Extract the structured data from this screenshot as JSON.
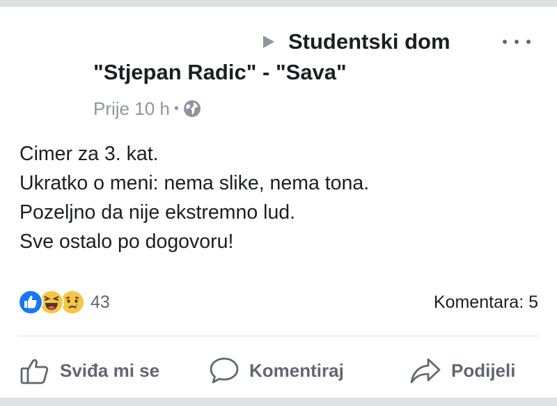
{
  "post": {
    "group_name_line1": "Studentski dom",
    "group_name_line2": "\"Stjepan Radic\" - \"Sava\"",
    "time": "Prije 10 h",
    "separator": "•",
    "privacy_icon": "globe-icon",
    "text_lines": [
      "Cimer za 3. kat.",
      "Ukratko o meni: nema slike, nema tona.",
      "Pozeljno da nije ekstremno lud.",
      "Sve ostalo po dogovoru!"
    ]
  },
  "reactions": {
    "icons": [
      "like-icon",
      "haha-icon",
      "sad-icon"
    ],
    "count": "43"
  },
  "comments": {
    "label": "Komentara: 5"
  },
  "actions": {
    "like_label": "Sviđa mi se",
    "comment_label": "Komentiraj",
    "share_label": "Podijeli"
  },
  "colors": {
    "like_blue": "#1877f2",
    "emoji_yellow": "#f7c544",
    "meta_gray": "#90949c",
    "action_gray": "#606770"
  }
}
